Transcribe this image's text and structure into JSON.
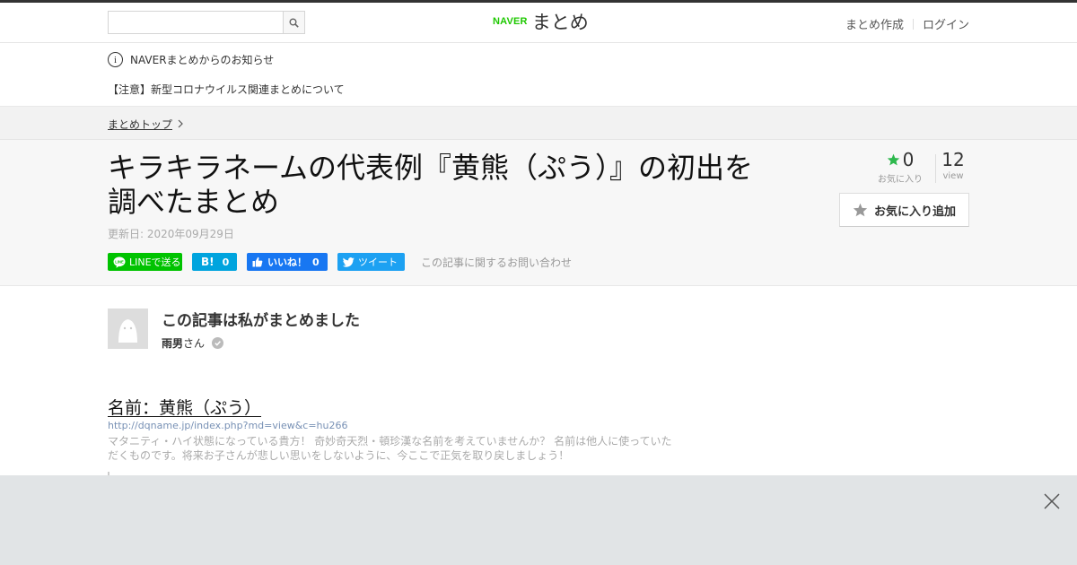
{
  "header": {
    "search_placeholder": "",
    "logo_naver": "NAVER",
    "logo_matome": "まとめ",
    "create_link": "まとめ作成",
    "login_link": "ログイン"
  },
  "notice": {
    "title": "NAVERまとめからのお知らせ",
    "link": "【注意】新型コロナウイルス関連まとめについて"
  },
  "breadcrumb": {
    "top": "まとめトップ"
  },
  "article": {
    "title": "キラキラネームの代表例『黄熊（ぷう）』の初出を調べたまとめ",
    "updated": "更新日: 2020年09月29日",
    "favorites": "0",
    "favorites_label": "お気に入り",
    "views": "12",
    "views_label": "view",
    "add_favorite": "お気に入り追加"
  },
  "share": {
    "line_label": "LINEで送る",
    "hatena_label": "B!",
    "hatena_count": "0",
    "fb_label": "いいね！",
    "fb_count": "0",
    "tw_label": "ツイート",
    "inquiry": "この記事に関するお問い合わせ"
  },
  "author": {
    "heading": "この記事は私がまとめました",
    "name": "雨男",
    "suffix": "さん"
  },
  "item": {
    "heading": "名前：黄熊（ぷう）",
    "url": "http://dqname.jp/index.php?md=view&c=hu266",
    "description": "マタニティ・ハイ状態になっている貴方！ 奇妙奇天烈・頓珍漢な名前を考えていませんか？ 名前は他人に使っていただくものです。将来お子さんが悲しい思いをしないように、今ここで正気を取り戻しましょう！"
  },
  "colors": {
    "line_green": "#00c300",
    "hatena_blue": "#00a4de",
    "facebook_blue": "#1877f2",
    "twitter_blue": "#1da1f2",
    "naver_green": "#1ec800",
    "fav_star": "#2db84d"
  }
}
